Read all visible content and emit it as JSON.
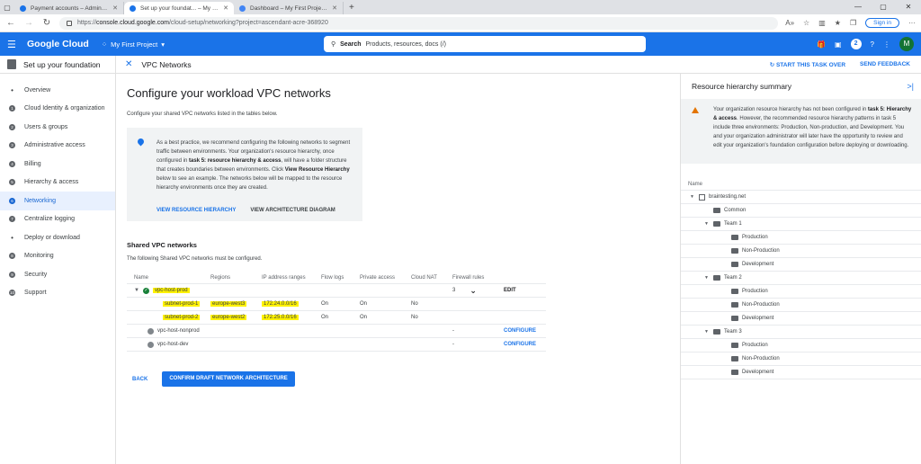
{
  "browser": {
    "tabs": [
      {
        "title": "Payment accounts – Admin Cons",
        "favicon": "#1a73e8",
        "active": false
      },
      {
        "title": "Set up your foundat... – My First",
        "favicon": "#1a73e8",
        "active": true
      },
      {
        "title": "Dashboard – My First Project – G",
        "favicon": "#4285f4",
        "active": false
      }
    ],
    "url_prefix": "https://",
    "url_domain": "console.cloud.google.com",
    "url_path": "/cloud-setup/networking?project=ascendant-acre-368920",
    "signin_label": "Sign in"
  },
  "header": {
    "logo": "Google Cloud",
    "project": "My First Project",
    "search_label": "Search",
    "search_hint": "Products, resources, docs (/)",
    "badge": "2",
    "avatar": "M"
  },
  "subheader": {
    "left_title": "Set up your foundation",
    "title": "VPC Networks",
    "start_label": "START THIS TASK OVER",
    "feedback_label": "SEND FEEDBACK"
  },
  "nav": [
    {
      "marker": "•",
      "label": "Overview",
      "type": "dot",
      "active": false
    },
    {
      "marker": "1",
      "label": "Cloud Identity & organization",
      "type": "num",
      "active": false
    },
    {
      "marker": "2",
      "label": "Users & groups",
      "type": "num",
      "active": false
    },
    {
      "marker": "3",
      "label": "Administrative access",
      "type": "num",
      "active": false
    },
    {
      "marker": "4",
      "label": "Billing",
      "type": "num",
      "active": false
    },
    {
      "marker": "5",
      "label": "Hierarchy & access",
      "type": "num",
      "active": false
    },
    {
      "marker": "6",
      "label": "Networking",
      "type": "num",
      "active": true
    },
    {
      "marker": "7",
      "label": "Centralize logging",
      "type": "num",
      "active": false
    },
    {
      "marker": "•",
      "label": "Deploy or download",
      "type": "dot",
      "active": false
    },
    {
      "marker": "8",
      "label": "Monitoring",
      "type": "num",
      "active": false
    },
    {
      "marker": "9",
      "label": "Security",
      "type": "num",
      "active": false
    },
    {
      "marker": "10",
      "label": "Support",
      "type": "num",
      "active": false
    }
  ],
  "main": {
    "title": "Configure your workload VPC networks",
    "description": "Configure your shared VPC networks listed in the tables below.",
    "info": {
      "t1": "As a best practice, we recommend configuring the following networks to segment traffic between environments. Your organization's resource hierarchy, once configured in ",
      "t2": "task 5: resource hierarchy & access",
      "t3": ", will have a folder structure that creates boundaries between environments. Click ",
      "t4": "View Resource Hierarchy",
      "t5": " below to see an example. The networks below will be mapped to the resource hierarchy environments once they are created.",
      "link1": "VIEW RESOURCE HIERARCHY",
      "link2": "VIEW ARCHITECTURE DIAGRAM"
    },
    "section_title": "Shared VPC networks",
    "section_desc": "The following Shared VPC networks must be configured.",
    "columns": {
      "name": "Name",
      "regions": "Regions",
      "ip": "IP address ranges",
      "flow": "Flow logs",
      "private": "Private access",
      "nat": "Cloud NAT",
      "fw": "Firewall rules"
    },
    "rows": {
      "prod": {
        "name": "vpc-host-prod",
        "fw": "3",
        "action": "EDIT"
      },
      "sub1": {
        "name": "subnet-prod-1",
        "region": "europe-west3",
        "ip": "172.24.0.0/16",
        "flow": "On",
        "private": "On",
        "nat": "No"
      },
      "sub2": {
        "name": "subnet-prod-2",
        "region": "europe-west2",
        "ip": "172.25.0.0/16",
        "flow": "On",
        "private": "On",
        "nat": "No"
      },
      "nonprod": {
        "name": "vpc-host-nonprod",
        "fw": "-",
        "action": "CONFIGURE"
      },
      "dev": {
        "name": "vpc-host-dev",
        "fw": "-",
        "action": "CONFIGURE"
      }
    },
    "back_label": "BACK",
    "confirm_label": "CONFIRM DRAFT NETWORK ARCHITECTURE"
  },
  "panel": {
    "title": "Resource hierarchy summary",
    "warn": {
      "t1": "Your organization resource hierarchy has not been configured in ",
      "t2": "task 5: Hierarchy & access",
      "t3": ". However, the recommended resource hierarchy patterns in task 5 include three environments: Production, Non-production, and Development. You and your organization administrator will later have the opportunity to review and edit your organization's foundation configuration before deploying or downloading."
    },
    "tree_header": "Name",
    "tree": [
      {
        "label": "braintesting.net",
        "level": 0,
        "kind": "org",
        "expand": true
      },
      {
        "label": "Common",
        "level": 1,
        "kind": "folder",
        "expand": false
      },
      {
        "label": "Team 1",
        "level": 1,
        "kind": "folder",
        "expand": true
      },
      {
        "label": "Production",
        "level": 2,
        "kind": "folder",
        "expand": false
      },
      {
        "label": "Non-Production",
        "level": 2,
        "kind": "folder",
        "expand": false
      },
      {
        "label": "Development",
        "level": 2,
        "kind": "folder",
        "expand": false
      },
      {
        "label": "Team 2",
        "level": 1,
        "kind": "folder",
        "expand": true
      },
      {
        "label": "Production",
        "level": 2,
        "kind": "folder",
        "expand": false
      },
      {
        "label": "Non-Production",
        "level": 2,
        "kind": "folder",
        "expand": false
      },
      {
        "label": "Development",
        "level": 2,
        "kind": "folder",
        "expand": false
      },
      {
        "label": "Team 3",
        "level": 1,
        "kind": "folder",
        "expand": true
      },
      {
        "label": "Production",
        "level": 2,
        "kind": "folder",
        "expand": false
      },
      {
        "label": "Non-Production",
        "level": 2,
        "kind": "folder",
        "expand": false
      },
      {
        "label": "Development",
        "level": 2,
        "kind": "folder",
        "expand": false
      }
    ]
  }
}
